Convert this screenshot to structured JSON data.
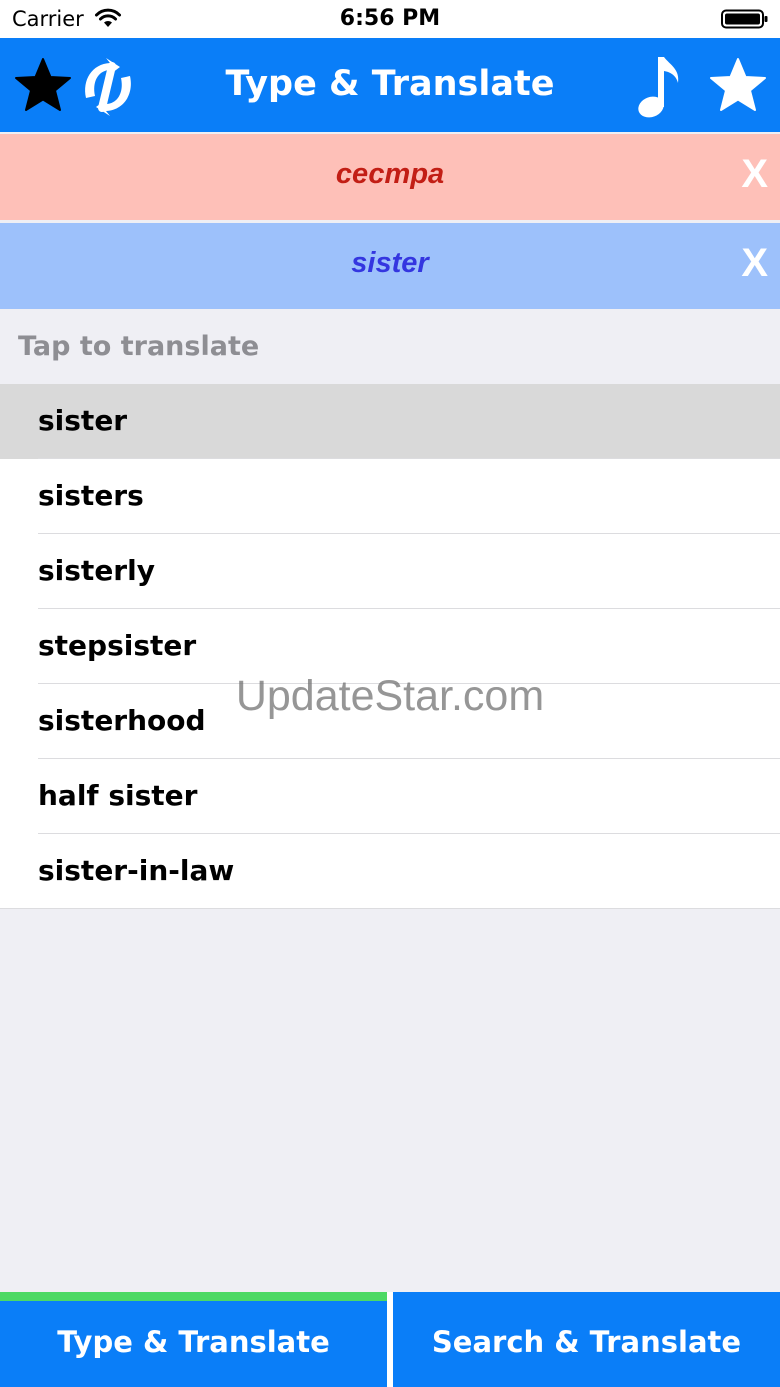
{
  "status": {
    "carrier": "Carrier",
    "time": "6:56 PM"
  },
  "navbar": {
    "title": "Type & Translate",
    "icons": [
      "favorites-list-star-icon",
      "swap-languages-icon",
      "music-note-icon",
      "add-favorite-star-icon"
    ]
  },
  "source": {
    "text": "сестра",
    "clear_label": "X"
  },
  "target": {
    "text": "sister",
    "clear_label": "X"
  },
  "suggestions": {
    "header": "Tap to translate",
    "items": [
      {
        "label": "sister"
      },
      {
        "label": "sisters"
      },
      {
        "label": "sisterly"
      },
      {
        "label": "stepsister"
      },
      {
        "label": "sisterhood"
      },
      {
        "label": "half sister"
      },
      {
        "label": "sister-in-law"
      }
    ]
  },
  "watermark": "UpdateStar.com",
  "tabs": [
    {
      "label": "Type & Translate"
    },
    {
      "label": "Search & Translate"
    }
  ],
  "colors": {
    "navbar": "#0a7ef8",
    "source_bg": "#fec0b8",
    "source_text": "#c21e15",
    "target_bg": "#9dc1fb",
    "target_text": "#3436e0",
    "active_tab_indicator": "#4cd964"
  }
}
